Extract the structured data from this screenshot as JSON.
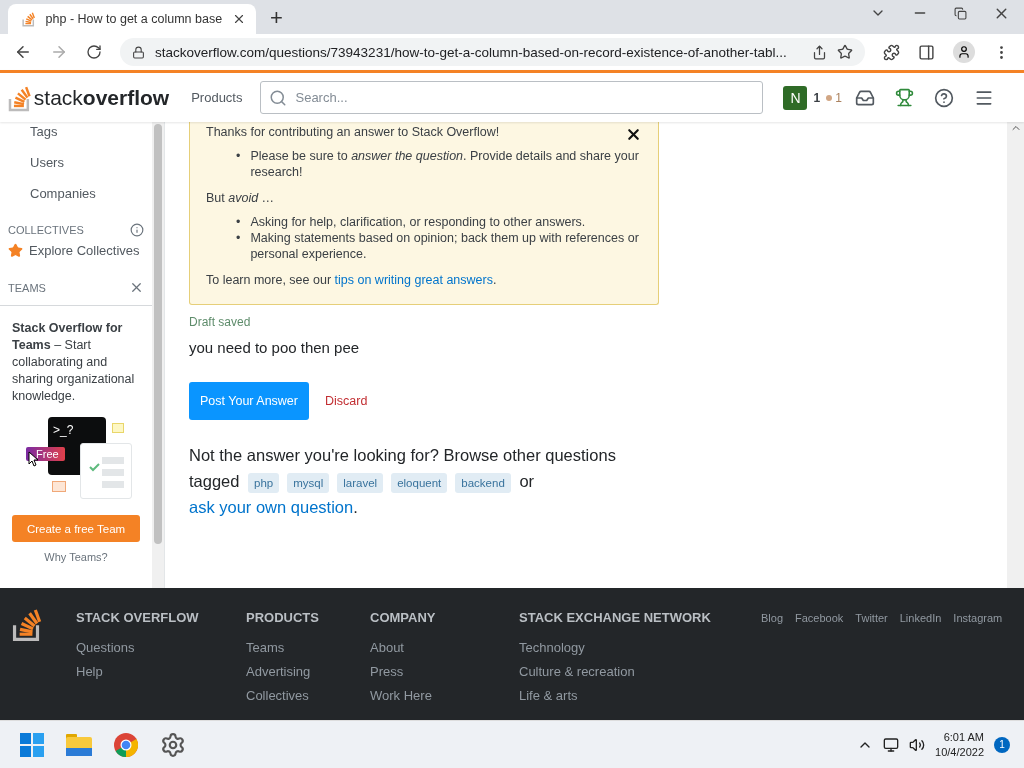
{
  "browser": {
    "tab_title": "php - How to get a column base",
    "new_tab": "+",
    "url": "stackoverflow.com/questions/73943231/how-to-get-a-column-based-on-record-existence-of-another-tabl..."
  },
  "header": {
    "logo_light": "stack",
    "logo_bold": "overflow",
    "products": "Products",
    "search": {
      "placeholder": "Search..."
    },
    "avatar": "N",
    "reputation": "1",
    "bronze_badges": "1"
  },
  "sidebar": {
    "nav_items": [
      {
        "label": "Tags"
      },
      {
        "label": "Users"
      },
      {
        "label": "Companies"
      }
    ],
    "collectives_heading": "COLLECTIVES",
    "explore": "Explore Collectives",
    "teams_heading": "TEAMS",
    "promo": {
      "text": "**Stack Overflow for Teams** – Start collaborating and sharing organizational knowledge.",
      "terminal_text": ">_?",
      "badge": "Free",
      "button": "Create a free Team",
      "link": "Why Teams?"
    }
  },
  "notice": {
    "bullet": "•",
    "intro": "Thanks for contributing an answer to Stack Overflow!",
    "do_items": [
      "Please be sure to *answer the question*. Provide details and share your research!"
    ],
    "avoid": "But *avoid* …",
    "avoid_items": [
      "Asking for help, clarification, or responding to other answers.",
      "Making statements based on opinion; back them up with references or personal experience."
    ],
    "learn_more": "To learn more, see our ",
    "learn_more_link": "tips on writing great answers",
    "learn_more_end": "."
  },
  "draft_status": "Draft saved",
  "answer_text": "you need to poo then pee",
  "post_button": "Post Your Answer",
  "discard_button": "Discard",
  "related": {
    "text": "Not the answer you're looking for? Browse other questions tagged",
    "tags": [
      "php",
      "mysql",
      "laravel",
      "eloquent",
      "backend"
    ],
    "or": "or",
    "link": "ask your own question",
    "end": "."
  },
  "footer": {
    "columns": [
      {
        "heading": "STACK OVERFLOW",
        "links": [
          "Questions",
          "Help"
        ]
      },
      {
        "heading": "PRODUCTS",
        "links": [
          "Teams",
          "Advertising",
          "Collectives"
        ]
      },
      {
        "heading": "COMPANY",
        "links": [
          "About",
          "Press",
          "Work Here"
        ]
      },
      {
        "heading": "STACK EXCHANGE NETWORK",
        "links": [
          "Technology",
          "Culture & recreation",
          "Life & arts"
        ]
      }
    ],
    "social": [
      "Blog",
      "Facebook",
      "Twitter",
      "LinkedIn",
      "Instagram"
    ]
  },
  "taskbar": {
    "time": "6:01 AM",
    "date": "10/4/2022",
    "notifications": "1"
  }
}
